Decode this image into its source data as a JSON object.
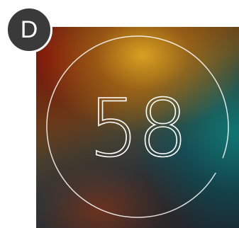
{
  "badge": {
    "label": "D"
  },
  "countdown": {
    "value": "58",
    "progress_fraction": 0.97
  },
  "colors": {
    "badge_bg": "#3a3a3a",
    "ring": "#ffffff",
    "digits": "#ffffff",
    "gradient_gold": "#dfa622",
    "gradient_red": "#821408",
    "gradient_teal": "#0f7873",
    "gradient_dark": "#15202a"
  }
}
